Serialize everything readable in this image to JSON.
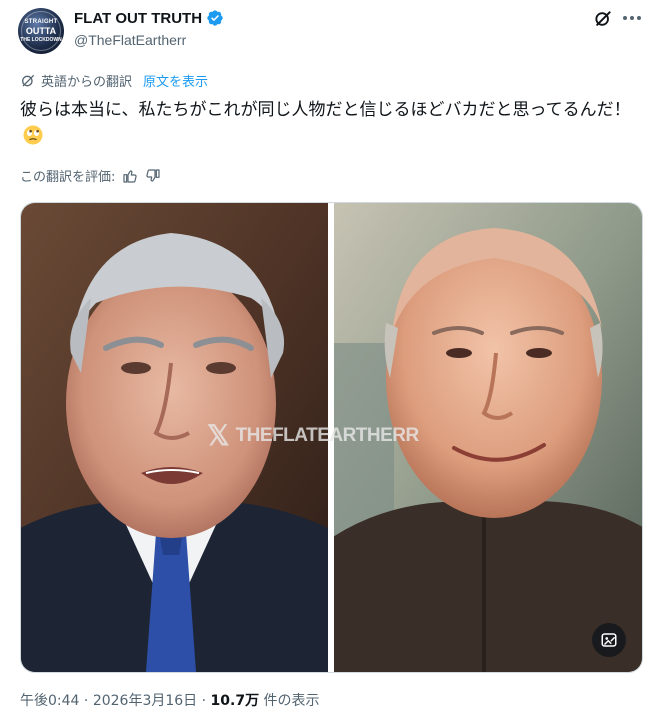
{
  "author": {
    "display_name": "FLAT OUT TRUTH",
    "handle": "@TheFlatEartherr",
    "avatar_text": [
      "STRAIGHT",
      "OUTTA",
      "THE LOCKDOWN"
    ]
  },
  "translation": {
    "label": "英語からの翻訳",
    "show_original": "原文を表示"
  },
  "post": {
    "text": "彼らは本当に、私たちがこれが同じ人物だと信じるほどバカだと思ってるんだ！"
  },
  "rating": {
    "label": "この翻訳を評価:"
  },
  "media": {
    "watermark": "THEFLATEARTHERR"
  },
  "meta": {
    "time": "午後0:44",
    "date": "2026年3月16日",
    "views": "10.7万",
    "views_suffix": "件の表示"
  },
  "colors": {
    "accent": "#1d9bf0",
    "secondary_text": "#536471"
  }
}
